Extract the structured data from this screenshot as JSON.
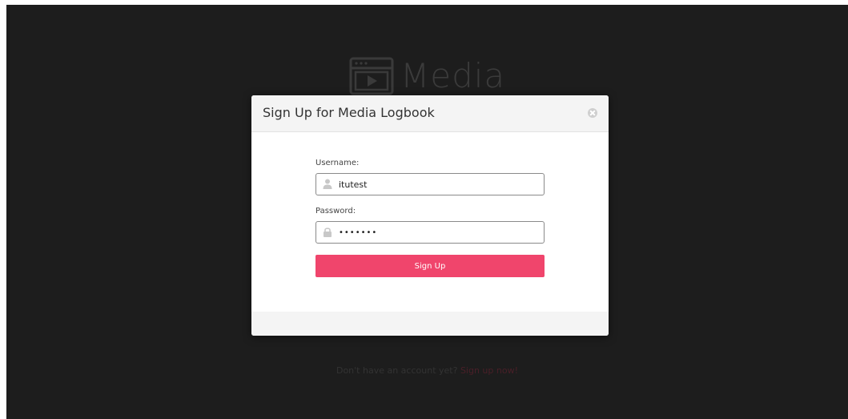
{
  "background": {
    "logo_text": "Media",
    "footer_text": "Don't have an account yet?",
    "footer_link": "Sign up now!"
  },
  "modal": {
    "title": "Sign Up for Media Logbook",
    "close_icon": "close-circle-icon",
    "username": {
      "label": "Username:",
      "value": "itutest",
      "icon": "user-icon"
    },
    "password": {
      "label": "Password:",
      "value": "1234567",
      "icon": "lock-icon"
    },
    "submit_label": "Sign Up"
  },
  "colors": {
    "accent": "#f0456c",
    "overlay": "#1d1d1d"
  }
}
